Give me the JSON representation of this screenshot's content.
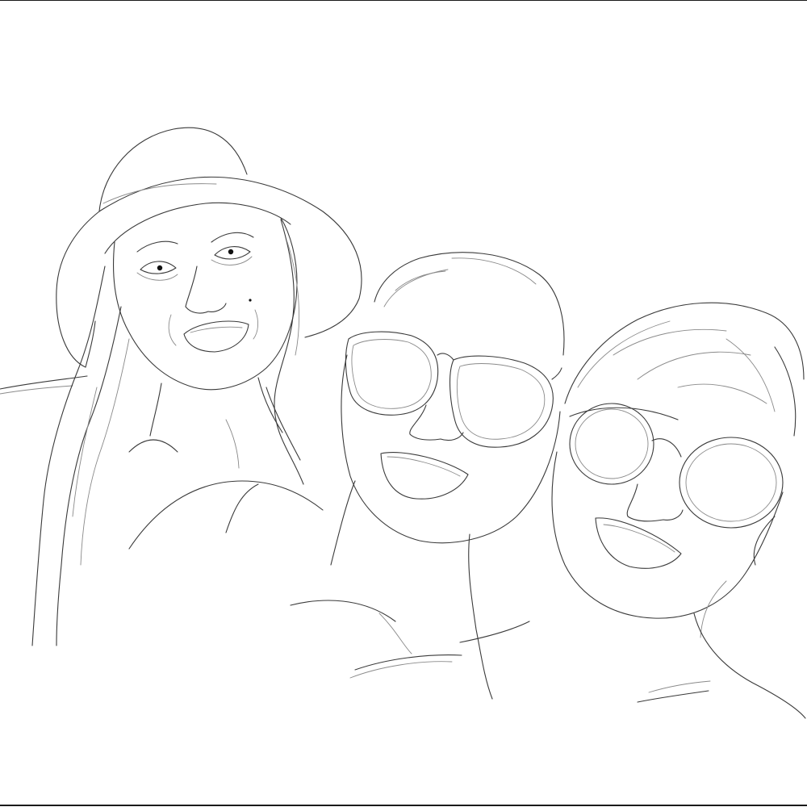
{
  "image": {
    "subject": "line-art",
    "people": [
      {
        "role": "woman-in-hat"
      },
      {
        "role": "woman-in-cat-eye-sunglasses"
      },
      {
        "role": "woman-in-round-sunglasses"
      }
    ]
  },
  "colors": {
    "background": "#ffffff",
    "line": "#3a3a3a",
    "light_line": "#8a8a8a",
    "frame": "#1a1a1a"
  }
}
